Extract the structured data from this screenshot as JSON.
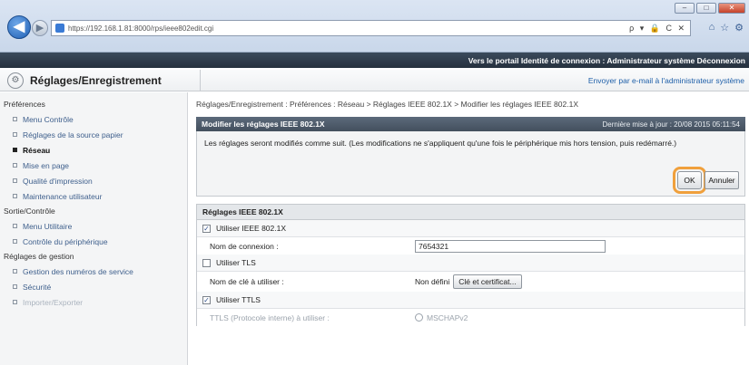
{
  "browser": {
    "url": "https://192.168.1.81:8000/rps/ieee802edit.cgi",
    "back_label": "◀",
    "forward_label": "▶",
    "address_tools": "ρ ▾ 🔒 C ✕",
    "toolbar_icons": [
      "⌂",
      "☆",
      "⚙"
    ]
  },
  "topbar": {
    "device_info": "",
    "links": "Vers le portail  Identité de connexion : Administrateur système  Déconnexion"
  },
  "header": {
    "title": "Réglages/Enregistrement",
    "send_mail": "Envoyer par e-mail à l'administrateur système"
  },
  "sidebar": {
    "sections": [
      {
        "heading": "Préférences",
        "items": [
          {
            "label": "Menu Contrôle"
          },
          {
            "label": "Réglages de la source papier"
          },
          {
            "label": "Réseau",
            "active": true
          },
          {
            "label": "Mise en page"
          },
          {
            "label": "Qualité d'impression"
          },
          {
            "label": "Maintenance utilisateur"
          }
        ]
      },
      {
        "heading": "Sortie/Contrôle",
        "items": [
          {
            "label": "Menu Utilitaire"
          },
          {
            "label": "Contrôle du périphérique"
          }
        ]
      },
      {
        "heading": "Réglages de gestion",
        "items": [
          {
            "label": "Gestion des numéros de service"
          },
          {
            "label": "Sécurité"
          },
          {
            "label": "Importer/Exporter"
          }
        ]
      }
    ]
  },
  "main": {
    "breadcrumb": "Réglages/Enregistrement : Préférences : Réseau > Réglages IEEE 802.1X > Modifier les réglages IEEE 802.1X",
    "panel_title": "Modifier les réglages IEEE 802.1X",
    "last_update": "Dernière mise à jour : 20/08 2015 05:11:54",
    "message": "Les réglages seront modifiés comme suit. (Les modifications ne s'appliquent qu'une fois le périphérique mis hors tension, puis redémarré.)",
    "ok_label": "OK",
    "cancel_label": "Annuler",
    "section_title": "Réglages IEEE 802.1X",
    "use_ieee_label": "Utiliser IEEE 802.1X",
    "use_ieee_checked": true,
    "login_name_label": "Nom de connexion :",
    "login_name_value": "7654321",
    "use_tls_label": "Utiliser TLS",
    "use_tls_checked": false,
    "key_name_label": "Nom de clé à utiliser :",
    "key_name_value": "Non défini",
    "key_button_label": "Clé et certificat...",
    "use_ttls_label": "Utiliser TTLS",
    "use_ttls_checked": true,
    "ttls_protocol_label": "TTLS (Protocole interne) à utiliser :",
    "ttls_option": "MSCHAPv2"
  }
}
